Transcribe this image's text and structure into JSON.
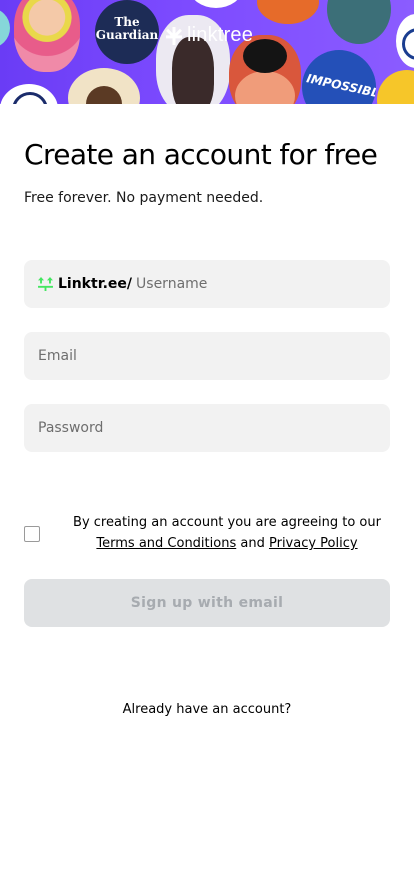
{
  "hero": {
    "brand": "linktree",
    "bubble_text_guardian": "The Guardian",
    "bubble_text_impossible": "IMPOSSIBLE"
  },
  "form": {
    "title": "Create an account for free",
    "subtitle": "Free forever. No payment needed.",
    "username_prefix": "Linktr.ee/",
    "username_placeholder": "Username",
    "email_placeholder": "Email",
    "password_placeholder": "Password",
    "agree_text_lead": "By creating an account you are agreeing to our",
    "terms_label": "Terms and Conditions",
    "and_text": "and",
    "privacy_label": "Privacy Policy",
    "signup_label": "Sign up with email",
    "login_prompt": "Already have an account?"
  },
  "colors": {
    "hero_purple": "#7d4bff",
    "linktree_green": "#43e660",
    "field_bg": "#f2f2f2",
    "button_disabled_bg": "#dfe1e3",
    "button_disabled_text": "#a7abb0"
  },
  "icons": {
    "logo": "linktree-asterisk-icon",
    "prefix": "linktree-icon",
    "checkbox": "checkbox-unchecked"
  }
}
